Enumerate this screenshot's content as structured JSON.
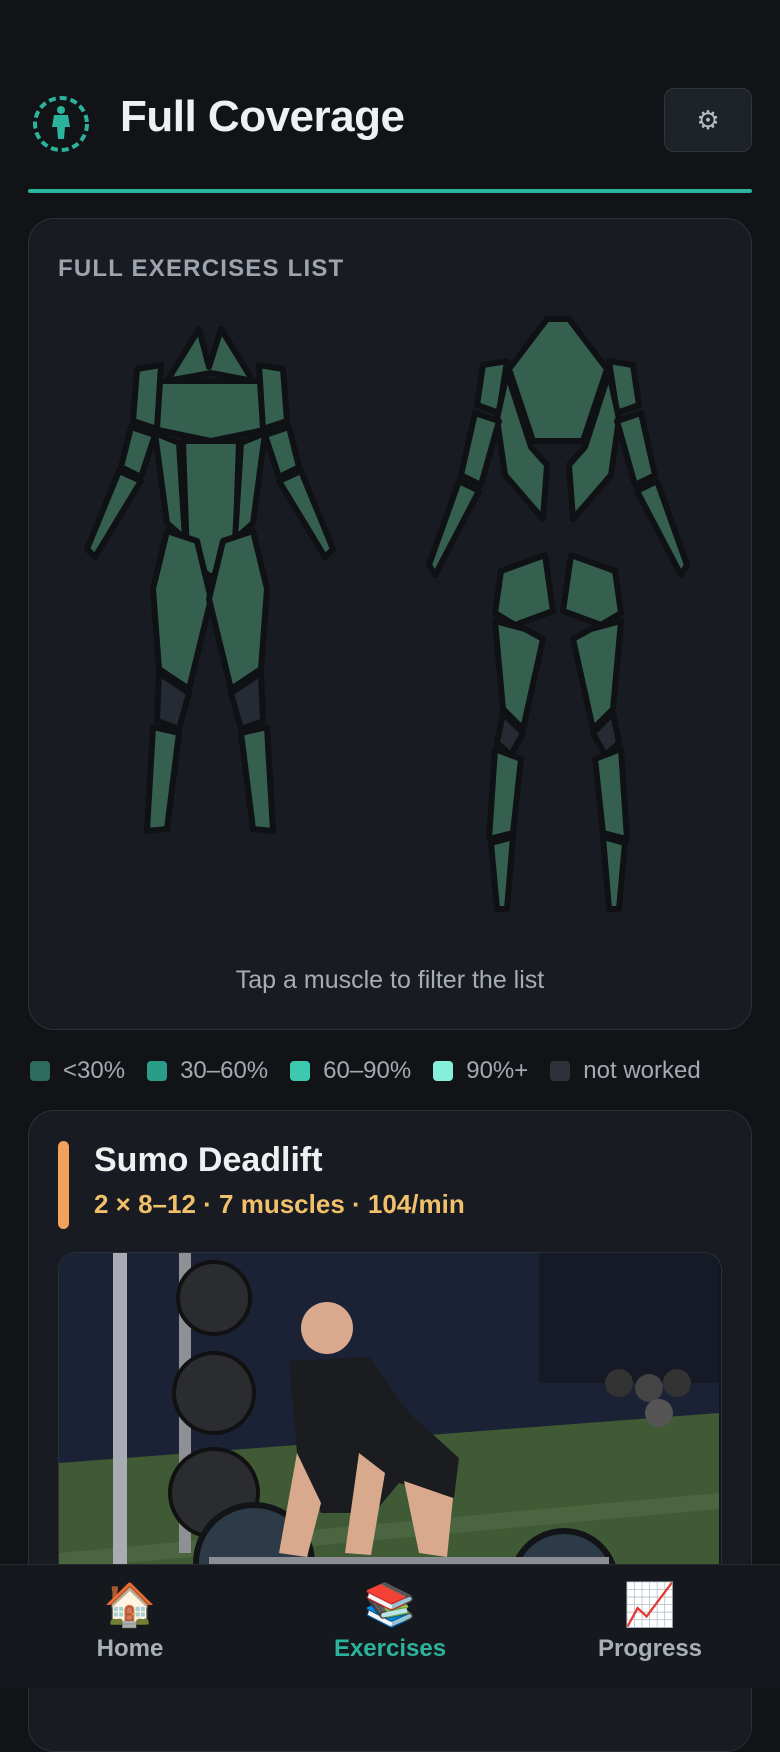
{
  "header": {
    "title": "Full Coverage",
    "settings_icon": "gear-icon",
    "settings_glyph": "⚙"
  },
  "body_map": {
    "heading": "FULL EXERCISES LIST",
    "hint": "Tap a muscle to filter the list"
  },
  "legend": [
    {
      "label": "<30%",
      "color": "#2d6b5c"
    },
    {
      "label": "30–60%",
      "color": "#2a9c88"
    },
    {
      "label": "60–90%",
      "color": "#3cc9ad"
    },
    {
      "label": "90%+",
      "color": "#86efd9"
    },
    {
      "label": "not worked",
      "color": "#2e323b"
    }
  ],
  "exercise": {
    "name": "Sumo Deadlift",
    "meta": "2 × 8–12 · 7 muscles · 104/min",
    "accent": "#f0a15c"
  },
  "nav": [
    {
      "label": "Home",
      "icon": "home-icon",
      "glyph": "🏠",
      "active": false
    },
    {
      "label": "Exercises",
      "icon": "books-icon",
      "glyph": "📚",
      "active": true
    },
    {
      "label": "Progress",
      "icon": "chart-icon",
      "glyph": "📈",
      "active": false
    }
  ],
  "colors": {
    "accent": "#2bb39b",
    "muscle_worked": "#35604f",
    "muscle_not_worked": "#262a33"
  }
}
